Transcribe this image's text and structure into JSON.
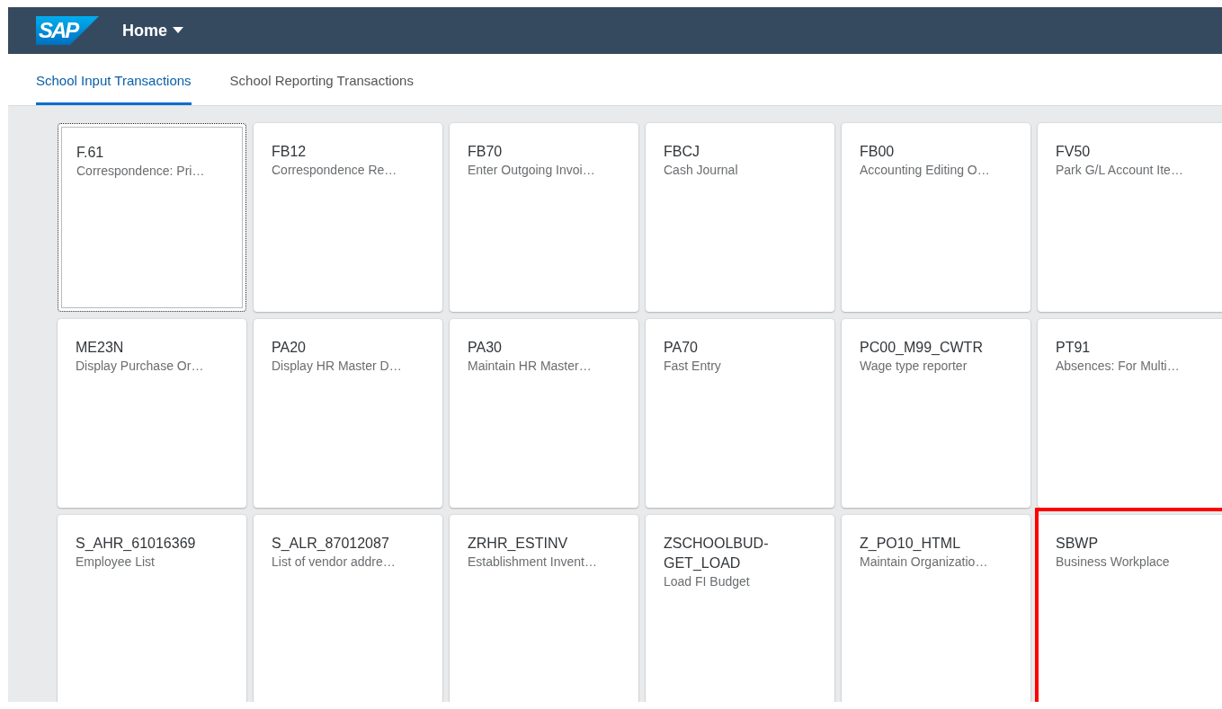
{
  "shell_bar": {
    "logo": "SAP",
    "title": "Home"
  },
  "tabs": [
    {
      "label": "School Input Transactions",
      "selected": true
    },
    {
      "label": "School Reporting Transactions",
      "selected": false
    }
  ],
  "tiles": [
    {
      "title": "F.61",
      "subtitle": "Correspondence: Pri…",
      "focused": true,
      "highlighted": false
    },
    {
      "title": "FB12",
      "subtitle": "Correspondence Re…",
      "focused": false,
      "highlighted": false
    },
    {
      "title": "FB70",
      "subtitle": "Enter Outgoing Invoi…",
      "focused": false,
      "highlighted": false
    },
    {
      "title": "FBCJ",
      "subtitle": "Cash Journal",
      "focused": false,
      "highlighted": false
    },
    {
      "title": "FB00",
      "subtitle": "Accounting Editing O…",
      "focused": false,
      "highlighted": false
    },
    {
      "title": "FV50",
      "subtitle": "Park G/L Account Ite…",
      "focused": false,
      "highlighted": false
    },
    {
      "title": "ME23N",
      "subtitle": "Display Purchase Or…",
      "focused": false,
      "highlighted": false
    },
    {
      "title": "PA20",
      "subtitle": "Display HR Master D…",
      "focused": false,
      "highlighted": false
    },
    {
      "title": "PA30",
      "subtitle": "Maintain HR Master…",
      "focused": false,
      "highlighted": false
    },
    {
      "title": "PA70",
      "subtitle": "Fast Entry",
      "focused": false,
      "highlighted": false
    },
    {
      "title": "PC00_M99_CWTR",
      "subtitle": "Wage type reporter",
      "focused": false,
      "highlighted": false
    },
    {
      "title": "PT91",
      "subtitle": "Absences: For Multi…",
      "focused": false,
      "highlighted": false
    },
    {
      "title": "S_AHR_61016369",
      "subtitle": "Employee List",
      "focused": false,
      "highlighted": false
    },
    {
      "title": "S_ALR_87012087",
      "subtitle": "List of vendor addre…",
      "focused": false,
      "highlighted": false
    },
    {
      "title": "ZRHR_ESTINV",
      "subtitle": "Establishment Invent…",
      "focused": false,
      "highlighted": false
    },
    {
      "title": "ZSCHOOLBUD-GET_LOAD",
      "subtitle": "Load FI Budget",
      "focused": false,
      "highlighted": false
    },
    {
      "title": "Z_PO10_HTML",
      "subtitle": "Maintain Organizatio…",
      "focused": false,
      "highlighted": false
    },
    {
      "title": "SBWP",
      "subtitle": "Business Workplace",
      "focused": false,
      "highlighted": true
    }
  ]
}
